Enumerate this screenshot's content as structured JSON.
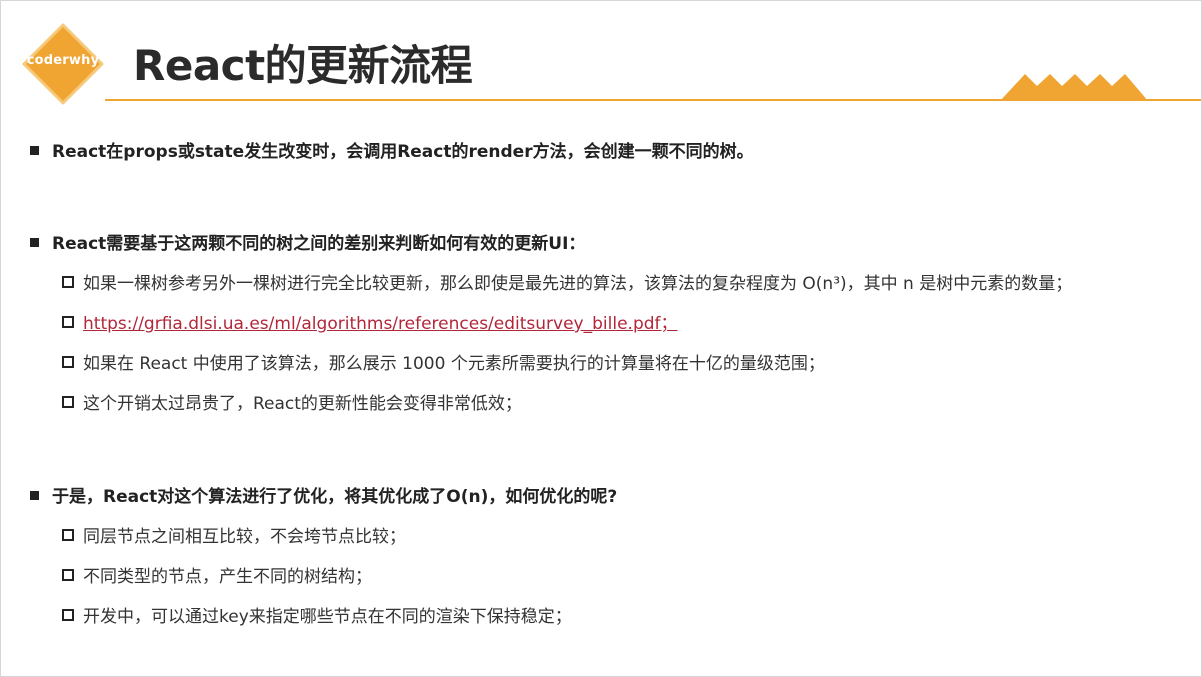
{
  "logo": {
    "text": "coderwhy"
  },
  "title": "React的更新流程",
  "sections": [
    {
      "heading": "React在props或state发生改变时，会调用React的render方法，会创建一颗不同的树。",
      "items": []
    },
    {
      "heading": "React需要基于这两颗不同的树之间的差别来判断如何有效的更新UI：",
      "items": [
        {
          "text": "如果一棵树参考另外一棵树进行完全比较更新，那么即使是最先进的算法，该算法的复杂程度为 O(n³)，其中 n 是树中元素的数量；"
        },
        {
          "text": "https://grfia.dlsi.ua.es/ml/algorithms/references/editsurvey_bille.pdf；",
          "is_link": true
        },
        {
          "text": "如果在 React 中使用了该算法，那么展示 1000 个元素所需要执行的计算量将在十亿的量级范围；"
        },
        {
          "text": "这个开销太过昂贵了，React的更新性能会变得非常低效；"
        }
      ]
    },
    {
      "heading": "于是，React对这个算法进行了优化，将其优化成了O(n)，如何优化的呢?",
      "items": [
        {
          "text": "同层节点之间相互比较，不会垮节点比较；"
        },
        {
          "text": "不同类型的节点，产生不同的树结构；"
        },
        {
          "text": "开发中，可以通过key来指定哪些节点在不同的渲染下保持稳定；"
        }
      ]
    }
  ],
  "colors": {
    "accent": "#f0a432",
    "link": "#b2263a",
    "text": "#222222"
  },
  "icons": [
    "logo-diamond-icon",
    "mountain-decoration-icon",
    "square-bullet-icon",
    "hollow-square-bullet-icon"
  ]
}
